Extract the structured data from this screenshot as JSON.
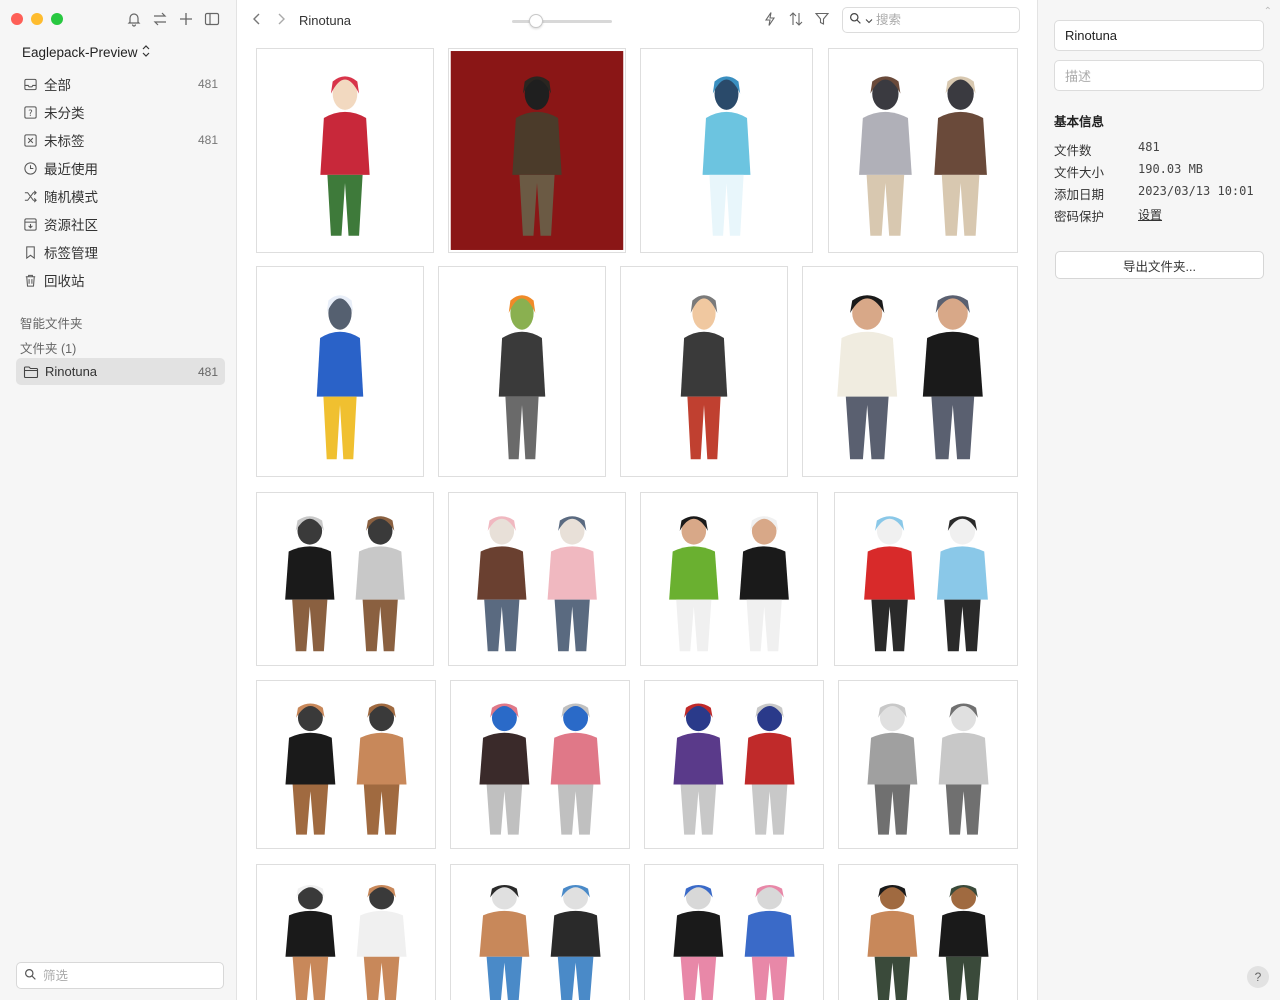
{
  "app": {
    "library_name": "Eaglepack-Preview",
    "library_chevron": "⌃⌄"
  },
  "sidebar": {
    "nav": [
      {
        "label": "全部",
        "count": "481",
        "icon": "inbox-icon"
      },
      {
        "label": "未分类",
        "count": "",
        "icon": "uncategorized-icon"
      },
      {
        "label": "未标签",
        "count": "481",
        "icon": "untagged-icon"
      },
      {
        "label": "最近使用",
        "count": "",
        "icon": "clock-icon"
      },
      {
        "label": "随机模式",
        "count": "",
        "icon": "shuffle-icon"
      },
      {
        "label": "资源社区",
        "count": "",
        "icon": "community-icon"
      },
      {
        "label": "标签管理",
        "count": "",
        "icon": "bookmark-icon"
      },
      {
        "label": "回收站",
        "count": "",
        "icon": "trash-icon"
      }
    ],
    "smart_folders_label": "智能文件夹",
    "folders_label": "文件夹 (1)",
    "folder": {
      "label": "Rinotuna",
      "count": "481"
    },
    "filter_placeholder": "筛选"
  },
  "toolbar": {
    "title": "Rinotuna",
    "search_placeholder": "搜索",
    "zoom_level": 0.2
  },
  "inspector": {
    "name_value": "Rinotuna",
    "desc_placeholder": "描述",
    "info_title": "基本信息",
    "rows": [
      {
        "key": "文件数",
        "value": "481"
      },
      {
        "key": "文件大小",
        "value": "190.03 MB"
      },
      {
        "key": "添加日期",
        "value": "2023/03/13 10:01"
      },
      {
        "key": "密码保护",
        "value": "设置"
      }
    ],
    "export_label": "导出文件夹...",
    "help_label": "?"
  },
  "thumbnails": [
    {
      "name": "thumb-strawberry-girl",
      "bg": "#ffffff",
      "palette": [
        "#c8283a",
        "#d8344a",
        "#3e7a3a",
        "#f2d9c0"
      ]
    },
    {
      "name": "thumb-orc-with-girl",
      "bg": "#8a1616",
      "palette": [
        "#4b3b2a",
        "#2a2520",
        "#6b5a44",
        "#1f1f1f"
      ]
    },
    {
      "name": "thumb-mouthwash-girl",
      "bg": "#ffffff",
      "palette": [
        "#6cc4e0",
        "#3a8fc0",
        "#e8f6fb",
        "#2a4a6a"
      ]
    },
    {
      "name": "thumb-chess-knight-girl",
      "bg": "#ffffff",
      "palette": [
        "#b0b0b8",
        "#6a4a3a",
        "#d8c8b0",
        "#3a3a40"
      ]
    },
    {
      "name": "thumb-police-officer",
      "bg": "#ffffff",
      "palette": [
        "#2a62c8",
        "#e8eef8",
        "#f0c030",
        "#556070"
      ]
    },
    {
      "name": "thumb-bunny-carrot",
      "bg": "#ffffff",
      "palette": [
        "#3a3a3a",
        "#f08a28",
        "#6a6a6a",
        "#8ab050"
      ]
    },
    {
      "name": "thumb-bunny-comic-sheet",
      "bg": "#ffffff",
      "palette": [
        "#3a3a3a",
        "#7a7a7a",
        "#c04030",
        "#f0c8a0"
      ]
    },
    {
      "name": "thumb-couple-sweater",
      "bg": "#ffffff",
      "palette": [
        "#f0ece0",
        "#1a1a1a",
        "#5a6070",
        "#d8a888"
      ]
    },
    {
      "name": "thumb-selfie-couple",
      "bg": "#ffffff",
      "palette": [
        "#1a1a1a",
        "#c8c8c8",
        "#8a6040",
        "#3a3a3a"
      ]
    },
    {
      "name": "thumb-skirt-couple",
      "bg": "#ffffff",
      "palette": [
        "#6a4030",
        "#f0b8c0",
        "#5a6a80",
        "#e8e0d8"
      ]
    },
    {
      "name": "thumb-green-hoodie-couple",
      "bg": "#ffffff",
      "palette": [
        "#6ab030",
        "#1a1a1a",
        "#f0f0f0",
        "#d8a888"
      ]
    },
    {
      "name": "thumb-winter-costumes",
      "bg": "#ffffff",
      "palette": [
        "#d82a2a",
        "#8ac8e8",
        "#2a2a2a",
        "#f0f0f0"
      ]
    },
    {
      "name": "thumb-masked-bunnies",
      "bg": "#ffffff",
      "palette": [
        "#1a1a1a",
        "#c8885a",
        "#a06a40",
        "#3a3a3a"
      ]
    },
    {
      "name": "thumb-demon-sketch-sheet",
      "bg": "#ffffff",
      "palette": [
        "#3a2a2a",
        "#e07888",
        "#c0c0c0",
        "#2a6ac8"
      ]
    },
    {
      "name": "thumb-villain-sketches",
      "bg": "#ffffff",
      "palette": [
        "#5a3a8a",
        "#c02a2a",
        "#c8c8c8",
        "#2a3a8a"
      ]
    },
    {
      "name": "thumb-pencil-bunny-sketch",
      "bg": "#ffffff",
      "palette": [
        "#a0a0a0",
        "#c8c8c8",
        "#707070",
        "#e0e0e0"
      ]
    },
    {
      "name": "thumb-sunglasses-poses",
      "bg": "#ffffff",
      "palette": [
        "#1a1a1a",
        "#f0f0f0",
        "#c8885a",
        "#3a3a3a"
      ]
    },
    {
      "name": "thumb-chair-pose",
      "bg": "#ffffff",
      "palette": [
        "#c8885a",
        "#2a2a2a",
        "#4a8ac8",
        "#e0e0e0"
      ]
    },
    {
      "name": "thumb-leather-jacket-group",
      "bg": "#ffffff",
      "palette": [
        "#1a1a1a",
        "#3a6ac8",
        "#e888a8",
        "#d8d8d8"
      ]
    },
    {
      "name": "thumb-fitness-couple",
      "bg": "#ffffff",
      "palette": [
        "#c8885a",
        "#1a1a1a",
        "#3a4a3a",
        "#a06a40"
      ]
    }
  ]
}
